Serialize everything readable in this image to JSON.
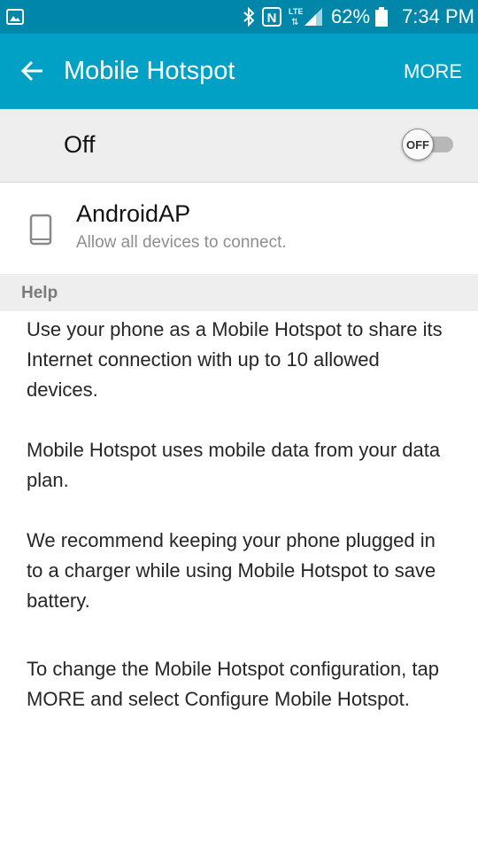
{
  "status_bar": {
    "battery_percent": "62%",
    "time": "7:34 PM",
    "network_type": "LTE",
    "icons": [
      "gallery-notification-icon",
      "bluetooth-icon",
      "nfc-icon",
      "signal-icon",
      "battery-icon"
    ]
  },
  "app_bar": {
    "title": "Mobile Hotspot",
    "more_label": "MORE",
    "back_icon": "arrow-left-icon",
    "background": "#00a1c5",
    "status_background": "#0086a8"
  },
  "master_switch": {
    "label": "Off",
    "toggle_text": "OFF",
    "enabled": false
  },
  "network": {
    "name": "AndroidAP",
    "subtitle": "Allow all devices to connect.",
    "icon": "phone-icon"
  },
  "help": {
    "header": "Help",
    "paragraphs": [
      "Use your phone as a Mobile Hotspot to share its Internet connection with up to 10 allowed devices.",
      "Mobile Hotspot uses mobile data from your data plan.",
      "We recommend keeping your phone plugged in to a charger while using Mobile Hotspot to save battery.",
      "To change the Mobile Hotspot configuration, tap MORE and select Configure Mobile Hotspot."
    ]
  }
}
